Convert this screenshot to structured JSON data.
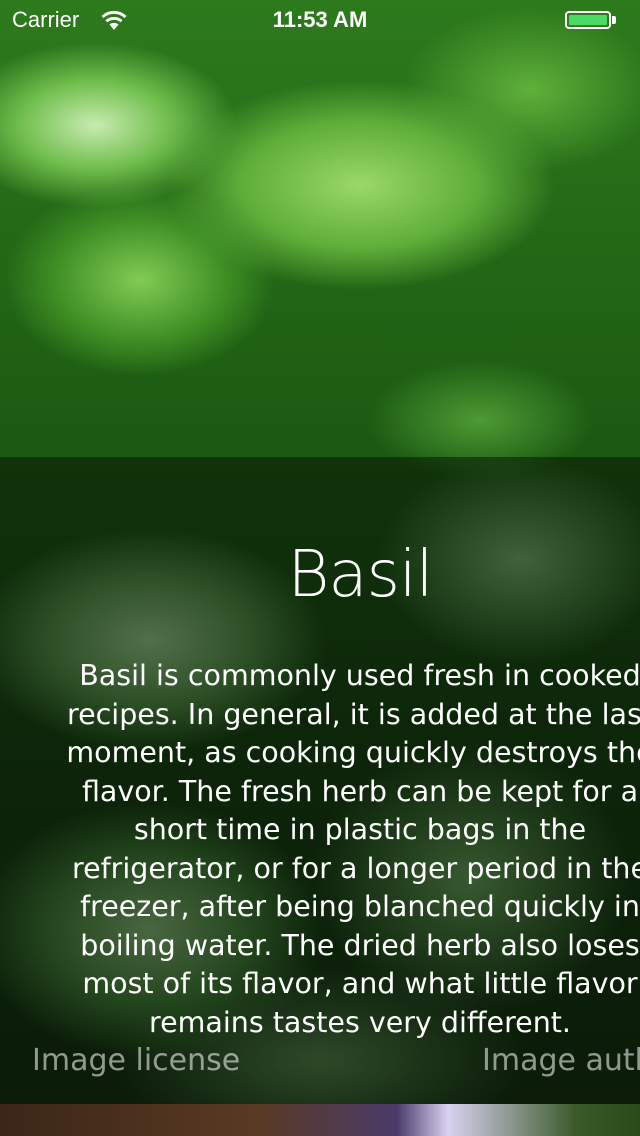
{
  "status_bar": {
    "carrier": "Carrier",
    "time": "11:53 AM",
    "battery_color": "#4cd964"
  },
  "herb": {
    "title": "Basil",
    "description_lines": [
      "Basil is commonly used fresh in cooked",
      "recipes. In general, it is added at the last",
      "moment, as cooking quickly destroys the",
      "flavor. The fresh herb can be kept for a",
      "short time in plastic bags in the",
      "refrigerator, or for a longer period in the",
      "freezer, after being blanched quickly in",
      "boiling water. The dried herb also loses",
      "most of its flavor, and what little flavor",
      "remains tastes very different."
    ],
    "background_image": "basil-leaves-photo"
  },
  "footer": {
    "image_license_label": "Image license",
    "image_author_label": "Image auth"
  },
  "icons": {
    "wifi": "wifi-icon",
    "battery": "battery-icon"
  }
}
